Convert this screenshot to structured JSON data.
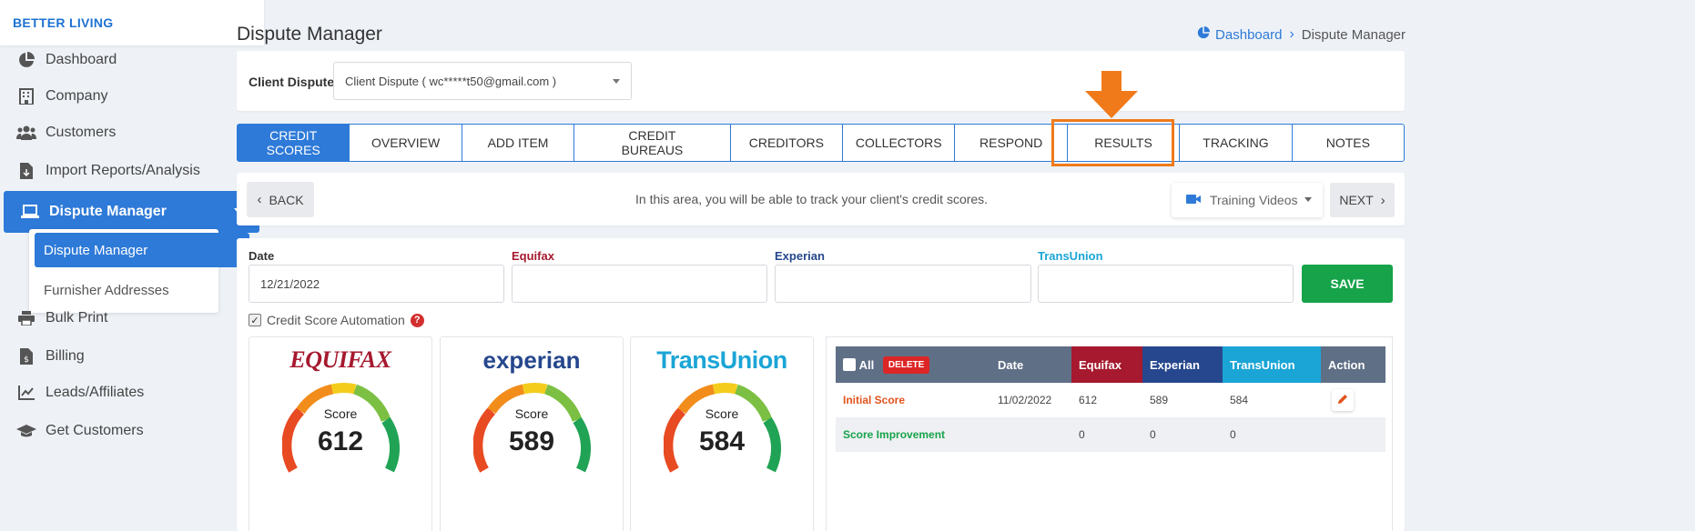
{
  "brand": "BETTER LIVING",
  "sidebar": {
    "items": [
      {
        "label": "Dashboard"
      },
      {
        "label": "Company"
      },
      {
        "label": "Customers"
      },
      {
        "label": "Import Reports/Analysis"
      },
      {
        "label": "Dispute Manager"
      },
      {
        "label": "Bulk Print"
      },
      {
        "label": "Billing"
      },
      {
        "label": "Leads/Affiliates"
      },
      {
        "label": "Get Customers"
      }
    ],
    "submenu": [
      {
        "label": "Dispute Manager"
      },
      {
        "label": "Furnisher Addresses"
      }
    ]
  },
  "header": {
    "title": "Dispute Manager",
    "breadcrumb": {
      "home": "Dashboard",
      "current": "Dispute Manager"
    }
  },
  "client": {
    "label": "Client Dispute",
    "selected": "Client Dispute ( wc*****t50@gmail.com )"
  },
  "tabs": [
    {
      "label": "CREDIT SCORES"
    },
    {
      "label": "OVERVIEW"
    },
    {
      "label": "ADD ITEM"
    },
    {
      "label": "CREDIT BUREAUS"
    },
    {
      "label": "CREDITORS"
    },
    {
      "label": "COLLECTORS"
    },
    {
      "label": "RESPOND"
    },
    {
      "label": "RESULTS"
    },
    {
      "label": "TRACKING"
    },
    {
      "label": "NOTES"
    }
  ],
  "info": {
    "back": "BACK",
    "text": "In this area, you will be able to track your client's credit scores.",
    "training": "Training Videos",
    "next": "NEXT"
  },
  "form": {
    "date_label": "Date",
    "date_value": "12/21/2022",
    "equifax_label": "Equifax",
    "experian_label": "Experian",
    "transunion_label": "TransUnion",
    "save": "SAVE",
    "automation": "Credit Score Automation"
  },
  "bureaus": [
    {
      "name": "EQUIFAX",
      "score_label": "Score",
      "score": "612"
    },
    {
      "name": "experian",
      "score_label": "Score",
      "score": "589"
    },
    {
      "name": "TransUnion",
      "score_label": "Score",
      "score": "584"
    }
  ],
  "table": {
    "headers": {
      "all": "All",
      "delete": "DELETE",
      "date": "Date",
      "equifax": "Equifax",
      "experian": "Experian",
      "transunion": "TransUnion",
      "action": "Action"
    },
    "rows": [
      {
        "label": "Initial Score",
        "date": "11/02/2022",
        "equifax": "612",
        "experian": "589",
        "transunion": "584"
      },
      {
        "label": "Score Improvement",
        "date": "",
        "equifax": "0",
        "experian": "0",
        "transunion": "0"
      }
    ]
  },
  "colors": {
    "primary": "#2e7ad8",
    "equifax": "#a6192e",
    "experian": "#26478d",
    "transunion": "#1ba5d6",
    "highlight": "#f07a1a",
    "save": "#16a34a"
  }
}
